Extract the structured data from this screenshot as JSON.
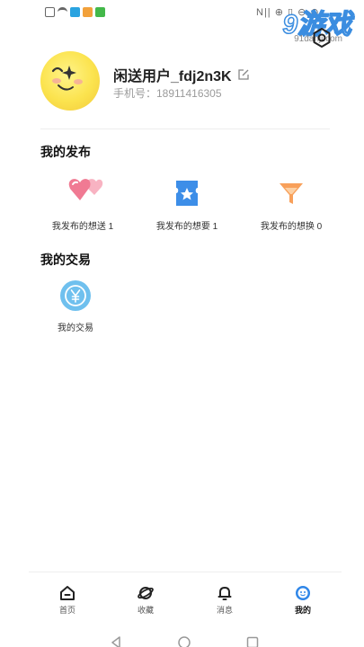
{
  "status_bar": {
    "right_text": "N|| ⊕ ▯ ⊖ ⊕"
  },
  "watermark": {
    "main": "9游戏",
    "sub": "91danji.com"
  },
  "profile": {
    "username": "闲送用户_fdj2n3K",
    "phone": "手机号：18911416305"
  },
  "sections": {
    "publish_title": "我的发布",
    "publish_items": [
      {
        "label": "我发布的想送  1"
      },
      {
        "label": "我发布的想要  1"
      },
      {
        "label": "我发布的想换  0"
      }
    ],
    "trade_title": "我的交易",
    "trade_items": [
      {
        "label": "我的交易"
      }
    ]
  },
  "bottom_nav": [
    {
      "label": "首页",
      "icon": "home-icon",
      "active": false
    },
    {
      "label": "收藏",
      "icon": "planet-icon",
      "active": false
    },
    {
      "label": "消息",
      "icon": "bell-icon",
      "active": false
    },
    {
      "label": "我的",
      "icon": "face-icon",
      "active": true
    }
  ],
  "colors": {
    "accent_blue": "#2f86e8",
    "heart_pink": "#f07a93",
    "swap_orange": "#f8a05a",
    "trade_blue": "#6fc0ee"
  }
}
